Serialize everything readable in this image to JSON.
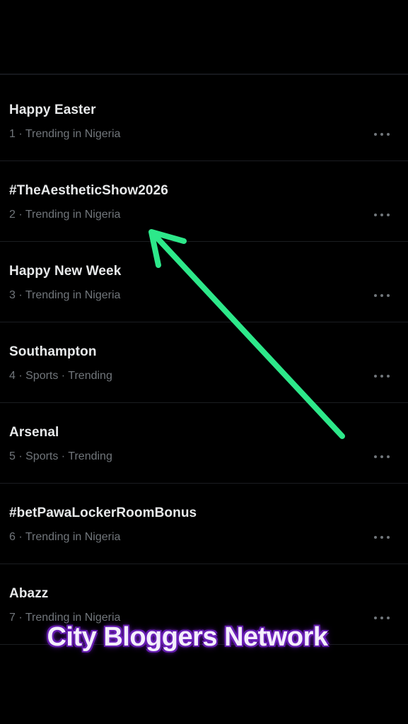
{
  "trends": [
    {
      "title": "Happy Easter",
      "meta": "1 · Trending in Nigeria"
    },
    {
      "title": "#TheAestheticShow2026",
      "meta": "2 · Trending in Nigeria"
    },
    {
      "title": "Happy New Week",
      "meta": "3 · Trending in Nigeria"
    },
    {
      "title": "Southampton",
      "meta": "4 · Sports · Trending"
    },
    {
      "title": "Arsenal",
      "meta": "5 · Sports · Trending"
    },
    {
      "title": "#betPawaLockerRoomBonus",
      "meta": "6 · Trending in Nigeria"
    },
    {
      "title": "Abazz",
      "meta": "7 · Trending in Nigeria"
    }
  ],
  "more_icon": "more-horizontal-icon",
  "annotation": {
    "arrow_color": "#2de88a",
    "arrow_icon": "arrow-up-left-icon"
  },
  "watermark": {
    "text": "City Bloggers Network",
    "glow_color": "#7a28c9"
  }
}
